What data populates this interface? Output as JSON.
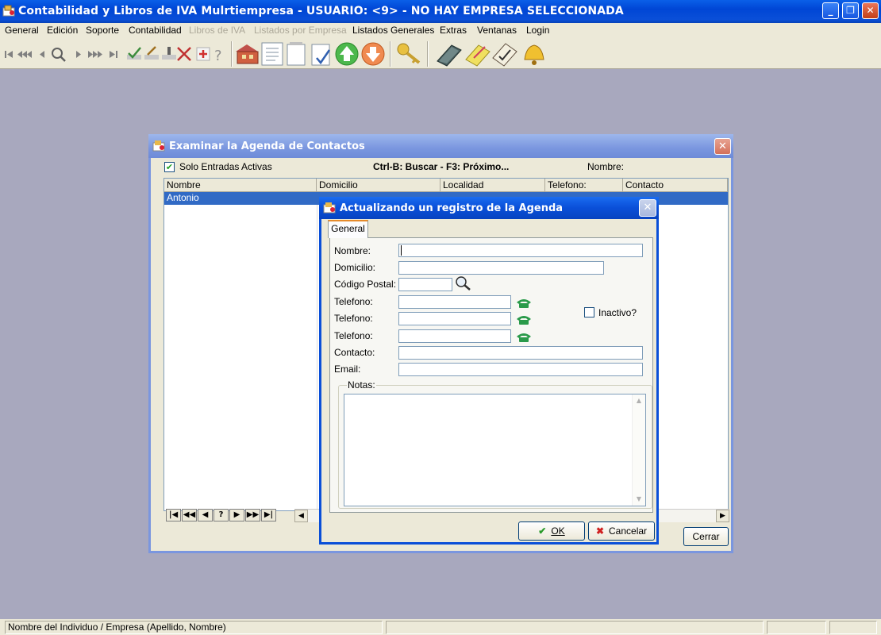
{
  "window": {
    "title": "Contabilidad y Libros de IVA Mulrtiempresa - USUARIO:  <9> - NO HAY EMPRESA SELECCIONADA",
    "minimize": "_",
    "restore": "❐",
    "close": "✕"
  },
  "menu": {
    "items": [
      {
        "label": "General",
        "enabled": true
      },
      {
        "label": "Edición",
        "enabled": true
      },
      {
        "label": "Soporte",
        "enabled": true
      },
      {
        "label": "Contabilidad",
        "enabled": true
      },
      {
        "label": "Libros de IVA",
        "enabled": false
      },
      {
        "label": "Listados por Empresa",
        "enabled": false
      },
      {
        "label": "Listados Generales",
        "enabled": true
      },
      {
        "label": "Extras",
        "enabled": true
      },
      {
        "label": "Ventanas",
        "enabled": true
      },
      {
        "label": "Login",
        "enabled": true
      }
    ]
  },
  "toolbar": {
    "icons": [
      "first-record-icon",
      "prev-page-icon",
      "prev-record-icon",
      "search-icon",
      "next-record-icon",
      "next-page-icon",
      "last-record-icon",
      "confirm-icon",
      "edit-icon",
      "insert-icon",
      "delete-icon",
      "add-icon",
      "help-icon",
      "company-icon",
      "document-icon",
      "notepad-icon",
      "checklist-icon",
      "up-arrow-icon",
      "down-arrow-icon",
      "key-icon",
      "book-icon",
      "notes-icon",
      "clipboard-icon",
      "bell-icon"
    ]
  },
  "examinar": {
    "title": "Examinar la Agenda de Contactos",
    "close": "✕",
    "checkbox_label": "Solo Entradas Activas",
    "checkbox_mark": "✔",
    "hint": "Ctrl-B: Buscar - F3: Próximo...",
    "search_label": "Nombre:",
    "columns": [
      "Nombre",
      "Domicilio",
      "Localidad",
      "Telefono:",
      "Contacto"
    ],
    "rows": [
      {
        "nombre": "Antonio"
      }
    ],
    "nav_buttons": [
      "|◀",
      "◀◀",
      "◀",
      "?",
      "▶",
      "▶▶",
      "▶|"
    ],
    "scroll_left": "◀",
    "scroll_right": "▶",
    "close_button": "Cerrar"
  },
  "dialog": {
    "title": "Actualizando un registro de la Agenda",
    "close": "✕",
    "tab": "General",
    "fields": {
      "nombre": "Nombre:",
      "domicilio": "Domicilio:",
      "codigo_postal": "Código Postal:",
      "telefono1": "Telefono:",
      "telefono2": "Telefono:",
      "telefono3": "Telefono:",
      "contacto": "Contacto:",
      "email": "Email:"
    },
    "values": {
      "nombre": "",
      "domicilio": "",
      "codigo_postal": "",
      "telefono1": "",
      "telefono2": "",
      "telefono3": "",
      "contacto": "",
      "email": ""
    },
    "inactivo_label": "Inactivo?",
    "notas_label": "Notas:",
    "scroll_up": "▲",
    "scroll_down": "▼",
    "ok_label": "OK",
    "ok_mark": "✔",
    "cancel_label": "Cancelar",
    "cancel_mark": "✖"
  },
  "status": {
    "message": "Nombre del Individuo / Empresa (Apellido, Nombre)"
  }
}
